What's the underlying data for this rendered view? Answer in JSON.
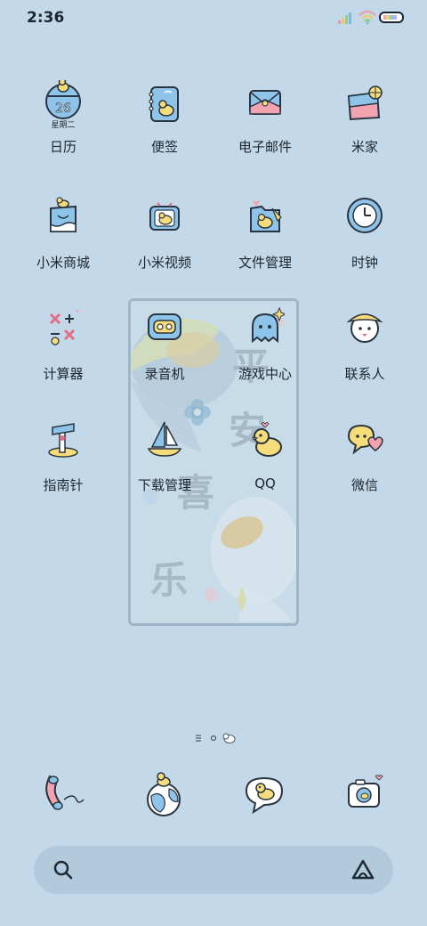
{
  "status_bar": {
    "time": "2:36",
    "icons": [
      "signal-icon",
      "wifi-icon",
      "battery-icon"
    ]
  },
  "calendar_icon": {
    "date": "26",
    "weekday": "星期二"
  },
  "apps": [
    {
      "label": "日历",
      "icon": "calendar-icon"
    },
    {
      "label": "便签",
      "icon": "notes-icon"
    },
    {
      "label": "电子邮件",
      "icon": "email-icon"
    },
    {
      "label": "米家",
      "icon": "mijia-icon"
    },
    {
      "label": "小米商城",
      "icon": "mi-store-icon"
    },
    {
      "label": "小米视频",
      "icon": "mi-video-icon"
    },
    {
      "label": "文件管理",
      "icon": "file-manager-icon"
    },
    {
      "label": "时钟",
      "icon": "clock-icon"
    },
    {
      "label": "计算器",
      "icon": "calculator-icon"
    },
    {
      "label": "录音机",
      "icon": "recorder-icon"
    },
    {
      "label": "游戏中心",
      "icon": "game-center-icon"
    },
    {
      "label": "联系人",
      "icon": "contacts-icon"
    },
    {
      "label": "指南针",
      "icon": "compass-icon"
    },
    {
      "label": "下载管理",
      "icon": "download-manager-icon"
    },
    {
      "label": "QQ",
      "icon": "qq-icon"
    },
    {
      "label": "微信",
      "icon": "wechat-icon"
    }
  ],
  "dock": [
    "phone-icon",
    "browser-icon",
    "messages-icon",
    "camera-icon"
  ],
  "colors": {
    "background": "#c3d9e9",
    "search_bar": "#b2cbdc",
    "duck_yellow": "#f6dc7a",
    "icon_blue": "#8ec4ea",
    "pink": "#f2a3b0"
  }
}
